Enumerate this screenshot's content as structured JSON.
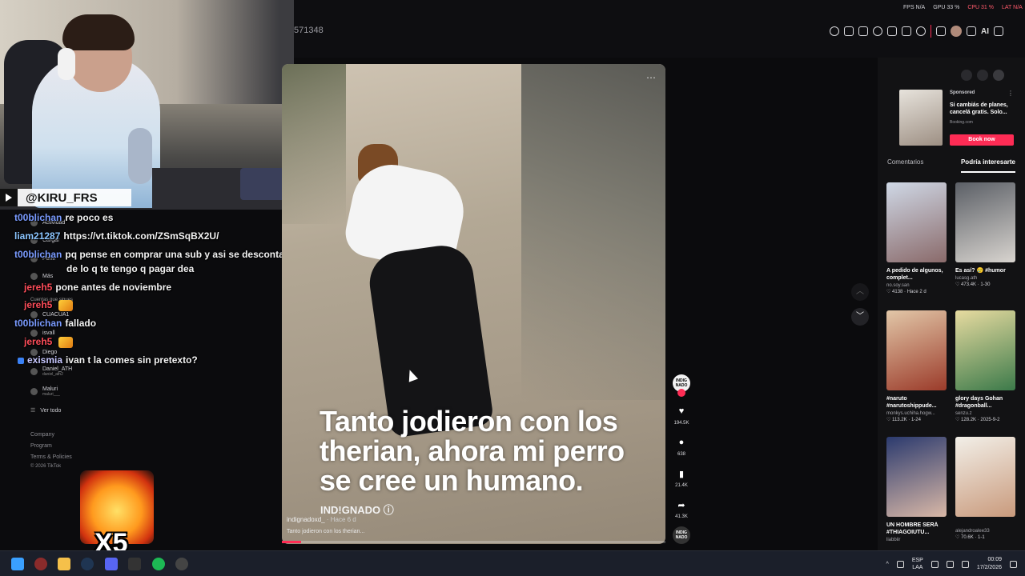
{
  "topbar": {
    "url_fragment": "571348",
    "perf": {
      "fps": "FPS N/A",
      "gpu": "GPU 33 %",
      "cpu": "CPU 31 %",
      "lat": "LAT N/A"
    },
    "ai_label": "AI"
  },
  "stream": {
    "handle": "@KIRU_FRS",
    "chat": [
      {
        "user": "t00blichan",
        "msg": "re poco es",
        "color": "#7a9bff"
      },
      {
        "user": "liam21287",
        "msg": "https://vt.tiktok.com/ZSmSqBX2U/",
        "color": "#8bc5ff"
      },
      {
        "user": "t00blichan",
        "msg": "pq pense en comprar una sub y asi se descontaba",
        "color": "#7a9bff"
      },
      {
        "user": "",
        "msg": "de lo q te tengo q pagar dea",
        "color": "#7a9bff"
      },
      {
        "user": "jereh5",
        "msg": "pone antes de noviembre",
        "color": "#ff4d5a"
      },
      {
        "user": "jereh5",
        "msg": "",
        "color": "#ff4d5a"
      },
      {
        "user": "t00blichan",
        "msg": "fallado",
        "color": "#7a9bff"
      },
      {
        "user": "jereh5",
        "msg": "",
        "color": "#ff4d5a"
      },
      {
        "user": "exismia",
        "msg": "ivan t la comes sin pretexto?",
        "color": "#c7c7ff"
      }
    ],
    "emote_multiplier": "X5"
  },
  "sidebar": {
    "items": [
      "Actividad",
      "Cargar",
      "Perfil",
      "Más"
    ],
    "following_header": "Cuentas que sigues",
    "accounts": [
      {
        "name": "CUACUA1",
        "sub": ""
      },
      {
        "name": "isvall",
        "sub": ""
      },
      {
        "name": "Diego",
        "sub": ""
      },
      {
        "name": "Daniel_ATH",
        "sub": "daniel_ath2"
      },
      {
        "name": "Maluri",
        "sub": "maluri___"
      }
    ],
    "see_all": "Ver todo",
    "footer": [
      "Company",
      "Program",
      "Terms & Policies",
      "© 2026 TikTok"
    ]
  },
  "video": {
    "caption": "Tanto jodieron con los therian, ahora mi perro se cree un humano.",
    "watermark": "IND!GNADO ⓘ",
    "author": "indignadoxd_",
    "time": " · Hace 6 d",
    "description": "Tanto jodieron con los therian...",
    "progress_pct": 5,
    "actions": {
      "avatar_label": "INDIG NADO",
      "likes": "194.5K",
      "comments": "638",
      "saves": "21.4K",
      "shares": "41.3K",
      "sound_label": "INDIG NADO"
    }
  },
  "ad": {
    "sponsored": "Sponsored",
    "title": "Si cambiás de planes, cancelá gratis. Solo...",
    "site": "Booking.com",
    "button": "Book now"
  },
  "tabs": {
    "comments": "Comentarios",
    "related": "Podría interesarte"
  },
  "related": [
    {
      "title": "A pedido de algunos, complet...",
      "author": "no.soy.san",
      "meta": "♡ 4138 · Hace 2 d",
      "c1": "#cfd8e6",
      "c2": "#8a6a6a"
    },
    {
      "title": "Es así? 🥲 #humor",
      "author": "lucasg.ath",
      "meta": "♡ 473.4K · 1-30",
      "c1": "#5b5f66",
      "c2": "#d8d4cf"
    },
    {
      "title": "#naruto #narutoshippude...",
      "author": "monkys.uchiha.hogw...",
      "meta": "♡ 113.2K · 1-24",
      "c1": "#e2c7a8",
      "c2": "#9b3b2a"
    },
    {
      "title": "glory days Gohan #dragonball...",
      "author": "senzu.z",
      "meta": "♡ 128.2K · 2025-9-2",
      "c1": "#e7dba0",
      "c2": "#3c7a4a"
    },
    {
      "title": "UN HOMBRE SERÁ #THIAGOIUTU...",
      "author": "liabbiir",
      "meta": "",
      "c1": "#2b3a6e",
      "c2": "#d9b8a7"
    },
    {
      "title": "",
      "author": "alejandroalee33",
      "meta": "♡ 70.6K · 1-1",
      "c1": "#f2efe8",
      "c2": "#c99a7c"
    }
  ],
  "tray": {
    "lang": "ESP",
    "region": "LAA",
    "time": "00:09",
    "date": "17/2/2026"
  }
}
